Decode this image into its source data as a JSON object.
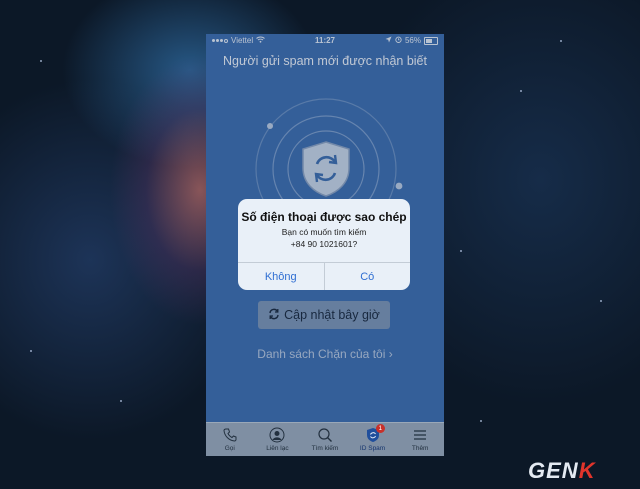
{
  "status_bar": {
    "carrier": "Viettel",
    "time": "11:27",
    "battery": "56%"
  },
  "main": {
    "title": "Người gửi spam mới được nhận biết",
    "update_button": "Cập nhật bây giờ",
    "blocklist_link": "Danh sách Chặn của tôi"
  },
  "dialog": {
    "title": "Số điện thoại được sao chép",
    "message_line1": "Bạn có muốn tìm kiếm",
    "message_line2": "+84 90 1021601?",
    "no_label": "Không",
    "yes_label": "Có"
  },
  "tabbar": {
    "items": [
      {
        "label": "Gọi",
        "icon": "phone-icon"
      },
      {
        "label": "Liên lạc",
        "icon": "contact-icon"
      },
      {
        "label": "Tìm kiếm",
        "icon": "search-icon"
      },
      {
        "label": "ID Spam",
        "icon": "shield-badge-icon",
        "badge": "1",
        "active": true
      },
      {
        "label": "Thêm",
        "icon": "menu-icon"
      }
    ]
  },
  "watermark": {
    "prefix": "GEN",
    "suffix": "K"
  },
  "colors": {
    "app_blue": "#3e6fb2",
    "dialog_accent": "#2f6ed2",
    "badge_red": "#c8302a"
  }
}
